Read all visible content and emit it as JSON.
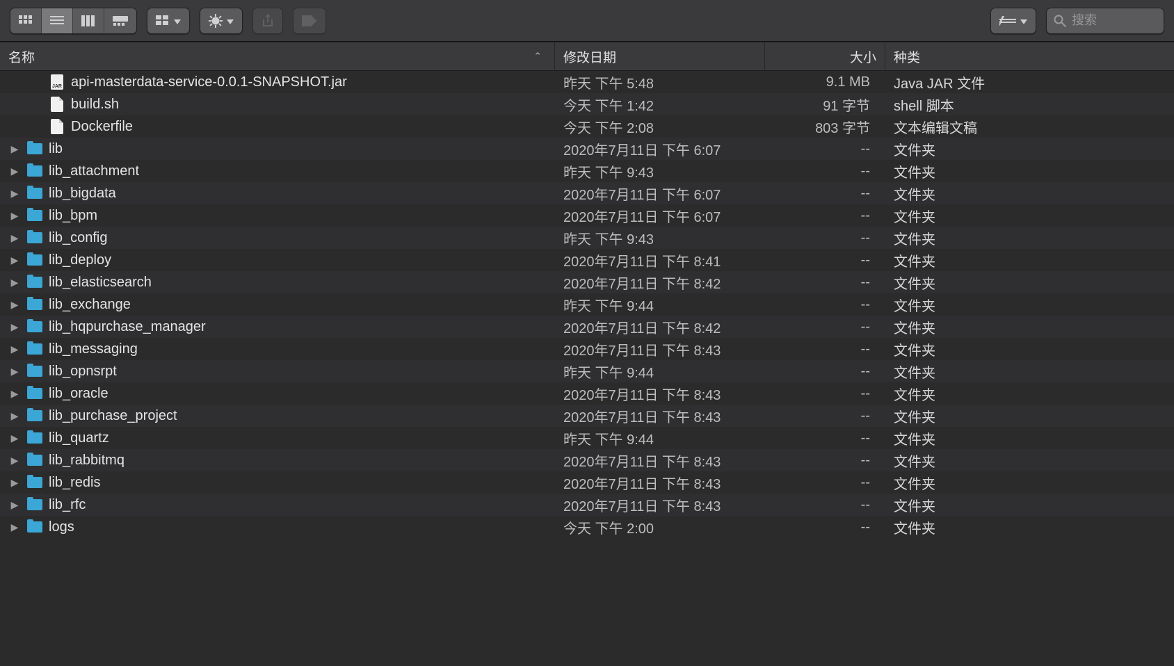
{
  "toolbar": {
    "search_placeholder": "搜索"
  },
  "columns": {
    "name": "名称",
    "date": "修改日期",
    "size": "大小",
    "kind": "种类"
  },
  "rows": [
    {
      "type": "jar",
      "name": "api-masterdata-service-0.0.1-SNAPSHOT.jar",
      "date": "昨天 下午 5:48",
      "size": "9.1 MB",
      "kind": "Java JAR 文件"
    },
    {
      "type": "file",
      "name": "build.sh",
      "date": "今天 下午 1:42",
      "size": "91 字节",
      "kind": "shell 脚本"
    },
    {
      "type": "file",
      "name": "Dockerfile",
      "date": "今天 下午 2:08",
      "size": "803 字节",
      "kind": "文本编辑文稿"
    },
    {
      "type": "folder",
      "name": "lib",
      "date": "2020年7月11日 下午 6:07",
      "size": "--",
      "kind": "文件夹"
    },
    {
      "type": "folder",
      "name": "lib_attachment",
      "date": "昨天 下午 9:43",
      "size": "--",
      "kind": "文件夹"
    },
    {
      "type": "folder",
      "name": "lib_bigdata",
      "date": "2020年7月11日 下午 6:07",
      "size": "--",
      "kind": "文件夹"
    },
    {
      "type": "folder",
      "name": "lib_bpm",
      "date": "2020年7月11日 下午 6:07",
      "size": "--",
      "kind": "文件夹"
    },
    {
      "type": "folder",
      "name": "lib_config",
      "date": "昨天 下午 9:43",
      "size": "--",
      "kind": "文件夹"
    },
    {
      "type": "folder",
      "name": "lib_deploy",
      "date": "2020年7月11日 下午 8:41",
      "size": "--",
      "kind": "文件夹"
    },
    {
      "type": "folder",
      "name": "lib_elasticsearch",
      "date": "2020年7月11日 下午 8:42",
      "size": "--",
      "kind": "文件夹"
    },
    {
      "type": "folder",
      "name": "lib_exchange",
      "date": "昨天 下午 9:44",
      "size": "--",
      "kind": "文件夹"
    },
    {
      "type": "folder",
      "name": "lib_hqpurchase_manager",
      "date": "2020年7月11日 下午 8:42",
      "size": "--",
      "kind": "文件夹"
    },
    {
      "type": "folder",
      "name": "lib_messaging",
      "date": "2020年7月11日 下午 8:43",
      "size": "--",
      "kind": "文件夹"
    },
    {
      "type": "folder",
      "name": "lib_opnsrpt",
      "date": "昨天 下午 9:44",
      "size": "--",
      "kind": "文件夹"
    },
    {
      "type": "folder",
      "name": "lib_oracle",
      "date": "2020年7月11日 下午 8:43",
      "size": "--",
      "kind": "文件夹"
    },
    {
      "type": "folder",
      "name": "lib_purchase_project",
      "date": "2020年7月11日 下午 8:43",
      "size": "--",
      "kind": "文件夹"
    },
    {
      "type": "folder",
      "name": "lib_quartz",
      "date": "昨天 下午 9:44",
      "size": "--",
      "kind": "文件夹"
    },
    {
      "type": "folder",
      "name": "lib_rabbitmq",
      "date": "2020年7月11日 下午 8:43",
      "size": "--",
      "kind": "文件夹"
    },
    {
      "type": "folder",
      "name": "lib_redis",
      "date": "2020年7月11日 下午 8:43",
      "size": "--",
      "kind": "文件夹"
    },
    {
      "type": "folder",
      "name": "lib_rfc",
      "date": "2020年7月11日 下午 8:43",
      "size": "--",
      "kind": "文件夹"
    },
    {
      "type": "folder",
      "name": "logs",
      "date": "今天 下午 2:00",
      "size": "--",
      "kind": "文件夹"
    }
  ]
}
